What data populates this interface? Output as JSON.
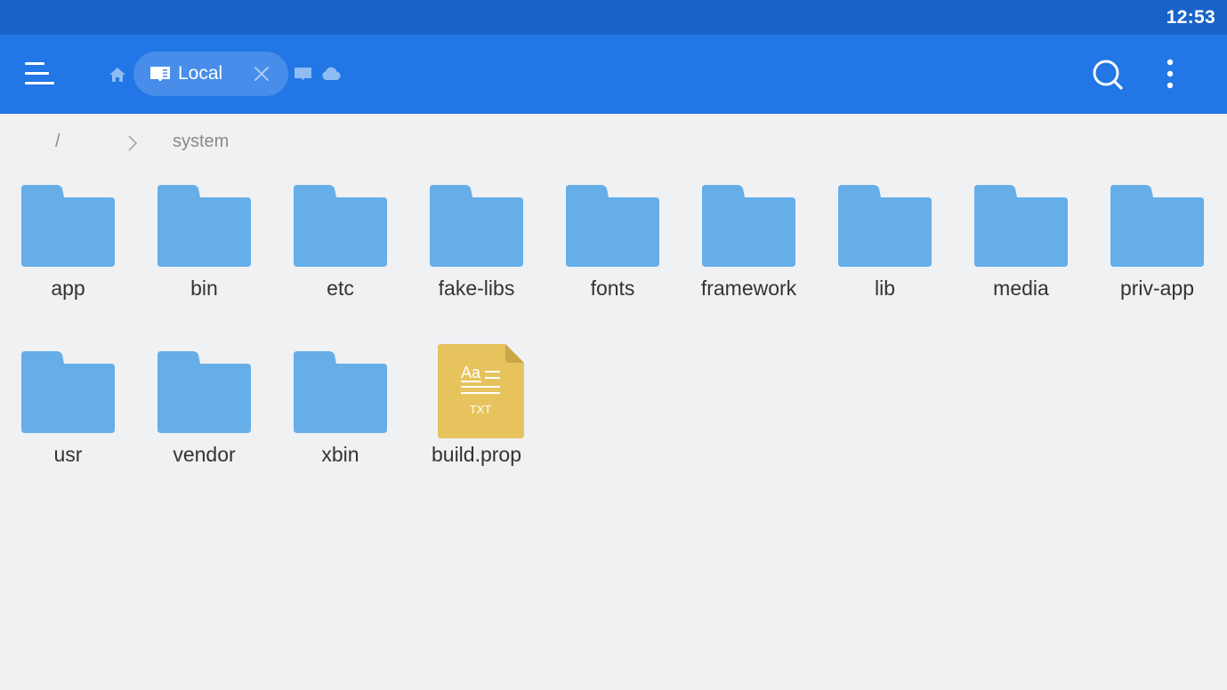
{
  "status_bar": {
    "time": "12:53"
  },
  "app_bar": {
    "menu_icon": "hamburger-menu-icon",
    "home_icon": "home-icon",
    "active_tab": {
      "icon": "device-storage-icon",
      "label": "Local",
      "close_icon": "close-icon"
    },
    "other_tabs": [
      {
        "icon": "sd-card-icon"
      },
      {
        "icon": "cloud-icon"
      }
    ],
    "search_icon": "search-icon",
    "more_icon": "more-vertical-icon"
  },
  "breadcrumb": {
    "root": "/",
    "separator_icon": "chevron-right-icon",
    "current": "system"
  },
  "files": [
    {
      "name": "app",
      "type": "folder"
    },
    {
      "name": "bin",
      "type": "folder"
    },
    {
      "name": "etc",
      "type": "folder"
    },
    {
      "name": "fake-libs",
      "type": "folder"
    },
    {
      "name": "fonts",
      "type": "folder"
    },
    {
      "name": "framework",
      "type": "folder"
    },
    {
      "name": "lib",
      "type": "folder"
    },
    {
      "name": "media",
      "type": "folder"
    },
    {
      "name": "priv-app",
      "type": "folder"
    },
    {
      "name": "usr",
      "type": "folder"
    },
    {
      "name": "vendor",
      "type": "folder"
    },
    {
      "name": "xbin",
      "type": "folder"
    },
    {
      "name": "build.prop",
      "type": "txt",
      "icon_glyph": "Aa",
      "icon_label": "TXT"
    }
  ],
  "colors": {
    "status_bar": "#1963c8",
    "app_bar": "#2276e5",
    "background": "#f0f1f3",
    "folder": "#66aee8",
    "txt_file": "#e6c35c"
  }
}
